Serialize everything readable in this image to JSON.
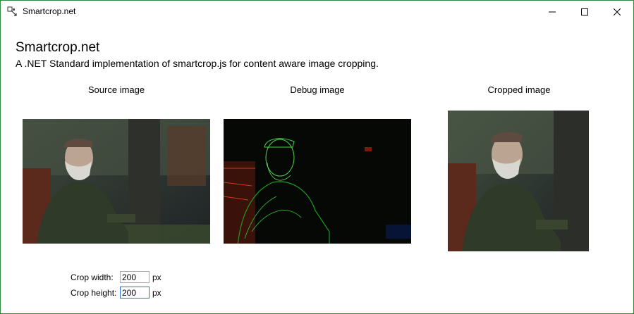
{
  "window": {
    "title": "Smartcrop.net",
    "accent": "#2d8a3a"
  },
  "header": {
    "title": "Smartcrop.net",
    "subtitle": "A .NET Standard implementation of smartcrop.js for content aware image cropping."
  },
  "columns": {
    "source_label": "Source image",
    "debug_label": "Debug image",
    "cropped_label": "Cropped image"
  },
  "form": {
    "crop_width_label": "Crop width:",
    "crop_width_value": "200",
    "crop_height_label": "Crop height:",
    "crop_height_value": "200",
    "unit": "px"
  },
  "icons": [
    "app-icon",
    "minimize-icon",
    "maximize-icon",
    "close-icon"
  ]
}
